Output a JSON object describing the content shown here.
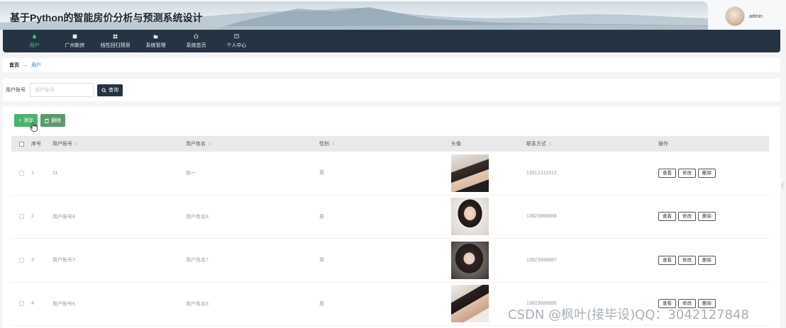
{
  "header": {
    "title": "基于Python的智能房价分析与预测系统设计",
    "username": "admin"
  },
  "nav": {
    "items": [
      {
        "label": "用户",
        "icon": "home-icon",
        "active": true
      },
      {
        "label": "广州新房",
        "icon": "grid-icon",
        "active": false
      },
      {
        "label": "线性回归预测",
        "icon": "apps-icon",
        "active": false
      },
      {
        "label": "系统管理",
        "icon": "folder-icon",
        "active": false
      },
      {
        "label": "系统首页",
        "icon": "house-icon",
        "active": false
      },
      {
        "label": "个人中心",
        "icon": "profile-icon",
        "active": false
      }
    ]
  },
  "breadcrumb": {
    "home": "首页",
    "separator": "—",
    "current": "用户"
  },
  "search": {
    "label": "用户账号",
    "placeholder": "用户账号",
    "button": "查询"
  },
  "toolbar": {
    "add": "添加",
    "delete": "删除"
  },
  "table": {
    "headers": {
      "index": "序号",
      "account": "用户账号",
      "name": "用户姓名",
      "sex": "性别",
      "avatar": "头像",
      "phone": "联系方式",
      "ops": "操作"
    },
    "rows": [
      {
        "index": "1",
        "account": "11",
        "name": "张一",
        "sex": "男",
        "phone": "13512312312"
      },
      {
        "index": "2",
        "account": "用户账号8",
        "name": "用户姓名8",
        "sex": "男",
        "phone": "13823888888"
      },
      {
        "index": "3",
        "account": "用户账号7",
        "name": "用户姓名7",
        "sex": "男",
        "phone": "13823868887"
      },
      {
        "index": "4",
        "account": "用户账号6",
        "name": "用户姓名6",
        "sex": "男",
        "phone": "13823888886"
      }
    ],
    "row_actions": {
      "view": "查看",
      "edit": "修改",
      "delete": "删除"
    }
  },
  "watermark": "CSDN @枫叶(接毕设)QQ：3042127848",
  "colors": {
    "nav_bg": "#243443",
    "accent_green": "#47b46b",
    "link_blue": "#2e7bd0"
  }
}
